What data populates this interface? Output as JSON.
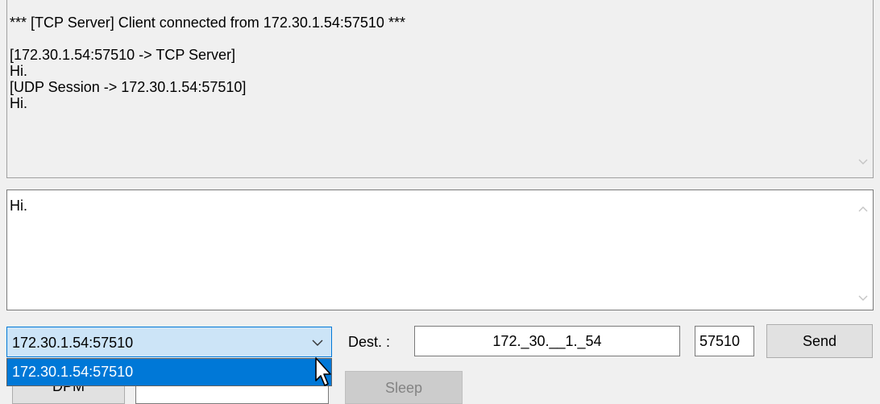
{
  "log": {
    "lines": [
      "*** [TCP Server] Client connected from 172.30.1.54:57510 ***",
      "",
      "[172.30.1.54:57510 -> TCP Server]",
      "Hi.",
      "[UDP Session -> 172.30.1.54:57510]",
      "Hi."
    ]
  },
  "compose": {
    "text": "Hi."
  },
  "session_select": {
    "selected": "172.30.1.54:57510",
    "options": [
      "172.30.1.54:57510"
    ]
  },
  "dest": {
    "label": "Dest. :",
    "ip": "172._30.__1._54",
    "port": "57510"
  },
  "buttons": {
    "send": "Send",
    "dpm": "DPM",
    "sleep": "Sleep"
  },
  "icons": {
    "combo_arrow": "chevron-down-icon",
    "scroll_down": "scroll-down-arrow-icon",
    "scroll_up": "scroll-up-arrow-icon",
    "cursor": "mouse-pointer-icon"
  },
  "colors": {
    "selection": "#0078d7",
    "combo_focus_bg": "#cce4f7",
    "window_bg": "#f0f0f0"
  }
}
